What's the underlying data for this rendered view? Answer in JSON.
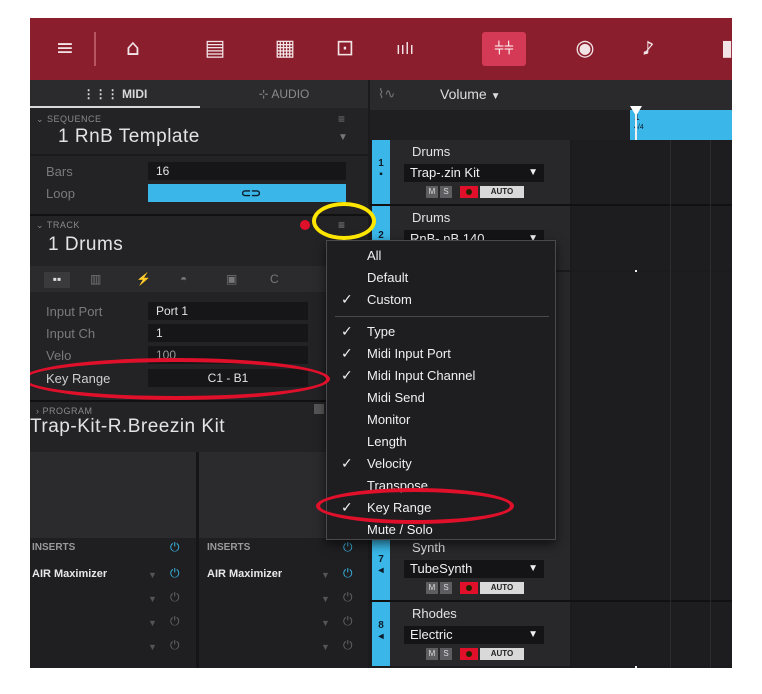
{
  "toolbar": {
    "icons": [
      "menu-icon",
      "browser-icon",
      "arrange-icon",
      "grid-icon",
      "sample-icon",
      "mixer-bars-icon",
      "mixer-icon",
      "record-icon",
      "cue-icon"
    ],
    "active": "mixer-icon"
  },
  "tabs": {
    "midi": "MIDI",
    "audio": "AUDIO"
  },
  "sequence": {
    "heading": "SEQUENCE",
    "name": "1 RnB Template",
    "bars_label": "Bars",
    "bars_value": "16",
    "loop_label": "Loop"
  },
  "track": {
    "heading": "TRACK",
    "name": "1 Drums"
  },
  "props": {
    "input_port_label": "Input Port",
    "input_port_value": "Port 1",
    "input_ch_label": "Input Ch",
    "input_ch_value": "1",
    "velo_label": "Velo",
    "velo_value": "100",
    "key_range_label": "Key Range",
    "key_range_value": "C1 - B1"
  },
  "program": {
    "heading": "PROGRAM",
    "name": "Trap-Kit-R.Breezin Kit"
  },
  "inserts": {
    "col1": {
      "title": "INSERTS",
      "item": "AIR Maximizer"
    },
    "col2": {
      "title": "INSERTS",
      "item": "AIR Maximizer"
    }
  },
  "arrange": {
    "volume_label": "Volume",
    "ruler_bar": "1",
    "ruler_sig": "4/4"
  },
  "tracks": [
    {
      "num": "1",
      "name": "Drums",
      "kit": "Trap-.zin Kit"
    },
    {
      "num": "2",
      "name": "Drums",
      "kit": "RnB-.nB 140"
    },
    {
      "num": "7",
      "name": "Synth",
      "kit": "TubeSynth"
    },
    {
      "num": "8",
      "name": "Rhodes",
      "kit": "Electric"
    }
  ],
  "track_buttons": {
    "mute": "M",
    "solo": "S",
    "auto": "AUTO"
  },
  "menu": {
    "items": [
      {
        "label": "All",
        "checked": false
      },
      {
        "label": "Default",
        "checked": false
      },
      {
        "label": "Custom",
        "checked": true
      },
      {
        "label": "Type",
        "checked": true
      },
      {
        "label": "Midi Input Port",
        "checked": true
      },
      {
        "label": "Midi Input Channel",
        "checked": true
      },
      {
        "label": "Midi Send",
        "checked": false
      },
      {
        "label": "Monitor",
        "checked": false
      },
      {
        "label": "Length",
        "checked": false
      },
      {
        "label": "Velocity",
        "checked": true
      },
      {
        "label": "Transpose",
        "checked": false
      },
      {
        "label": "Key Range",
        "checked": true
      },
      {
        "label": "Mute / Solo",
        "checked": false
      }
    ],
    "check_glyph": "✓"
  },
  "colors": {
    "toolbar": "#8b1e2c",
    "accent_blue": "#3ab7e8",
    "annotation_red": "#e0102b",
    "annotation_yellow": "#ffe600"
  }
}
